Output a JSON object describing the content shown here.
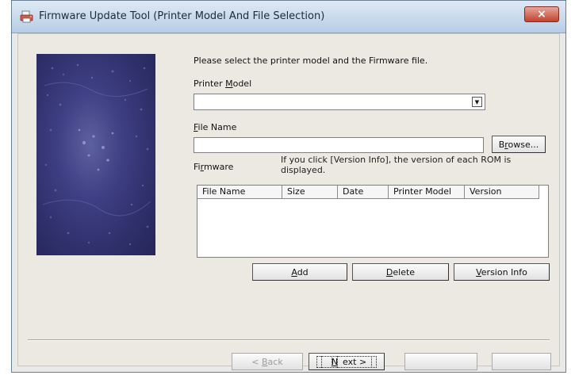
{
  "window": {
    "title": "Firmware Update Tool (Printer Model And File Selection)",
    "close_glyph": "×"
  },
  "instruction": "Please select the printer model and the Firmware file.",
  "printer_model": {
    "label_pre": "Printer ",
    "label_accel": "M",
    "label_post": "odel",
    "value": ""
  },
  "file_name": {
    "label_accel": "F",
    "label_post": "ile Name",
    "value": "",
    "browse_pre": "B",
    "browse_accel": "r",
    "browse_post": "owse..."
  },
  "firmware": {
    "label_pre": "Fi",
    "label_accel": "r",
    "label_post": "mware",
    "note": "If you click [Version Info], the version of each ROM is displayed.",
    "columns": [
      "File Name",
      "Size",
      "Date",
      "Printer Model",
      "Version"
    ]
  },
  "actions": {
    "add_accel": "A",
    "add_post": "dd",
    "delete_accel": "D",
    "delete_post": "elete",
    "version_accel": "V",
    "version_post": "ersion Info"
  },
  "wizard": {
    "back_pre": "< ",
    "back_accel": "B",
    "back_post": "ack",
    "next_pre": "",
    "next_accel": "N",
    "next_post": "ext >",
    "btn3": "",
    "btn4": ""
  },
  "colors": {
    "titlebar": "#b7cde6",
    "close": "#c2432f",
    "side_image": "#2f2f6a",
    "dialog": "#ece9e2"
  }
}
